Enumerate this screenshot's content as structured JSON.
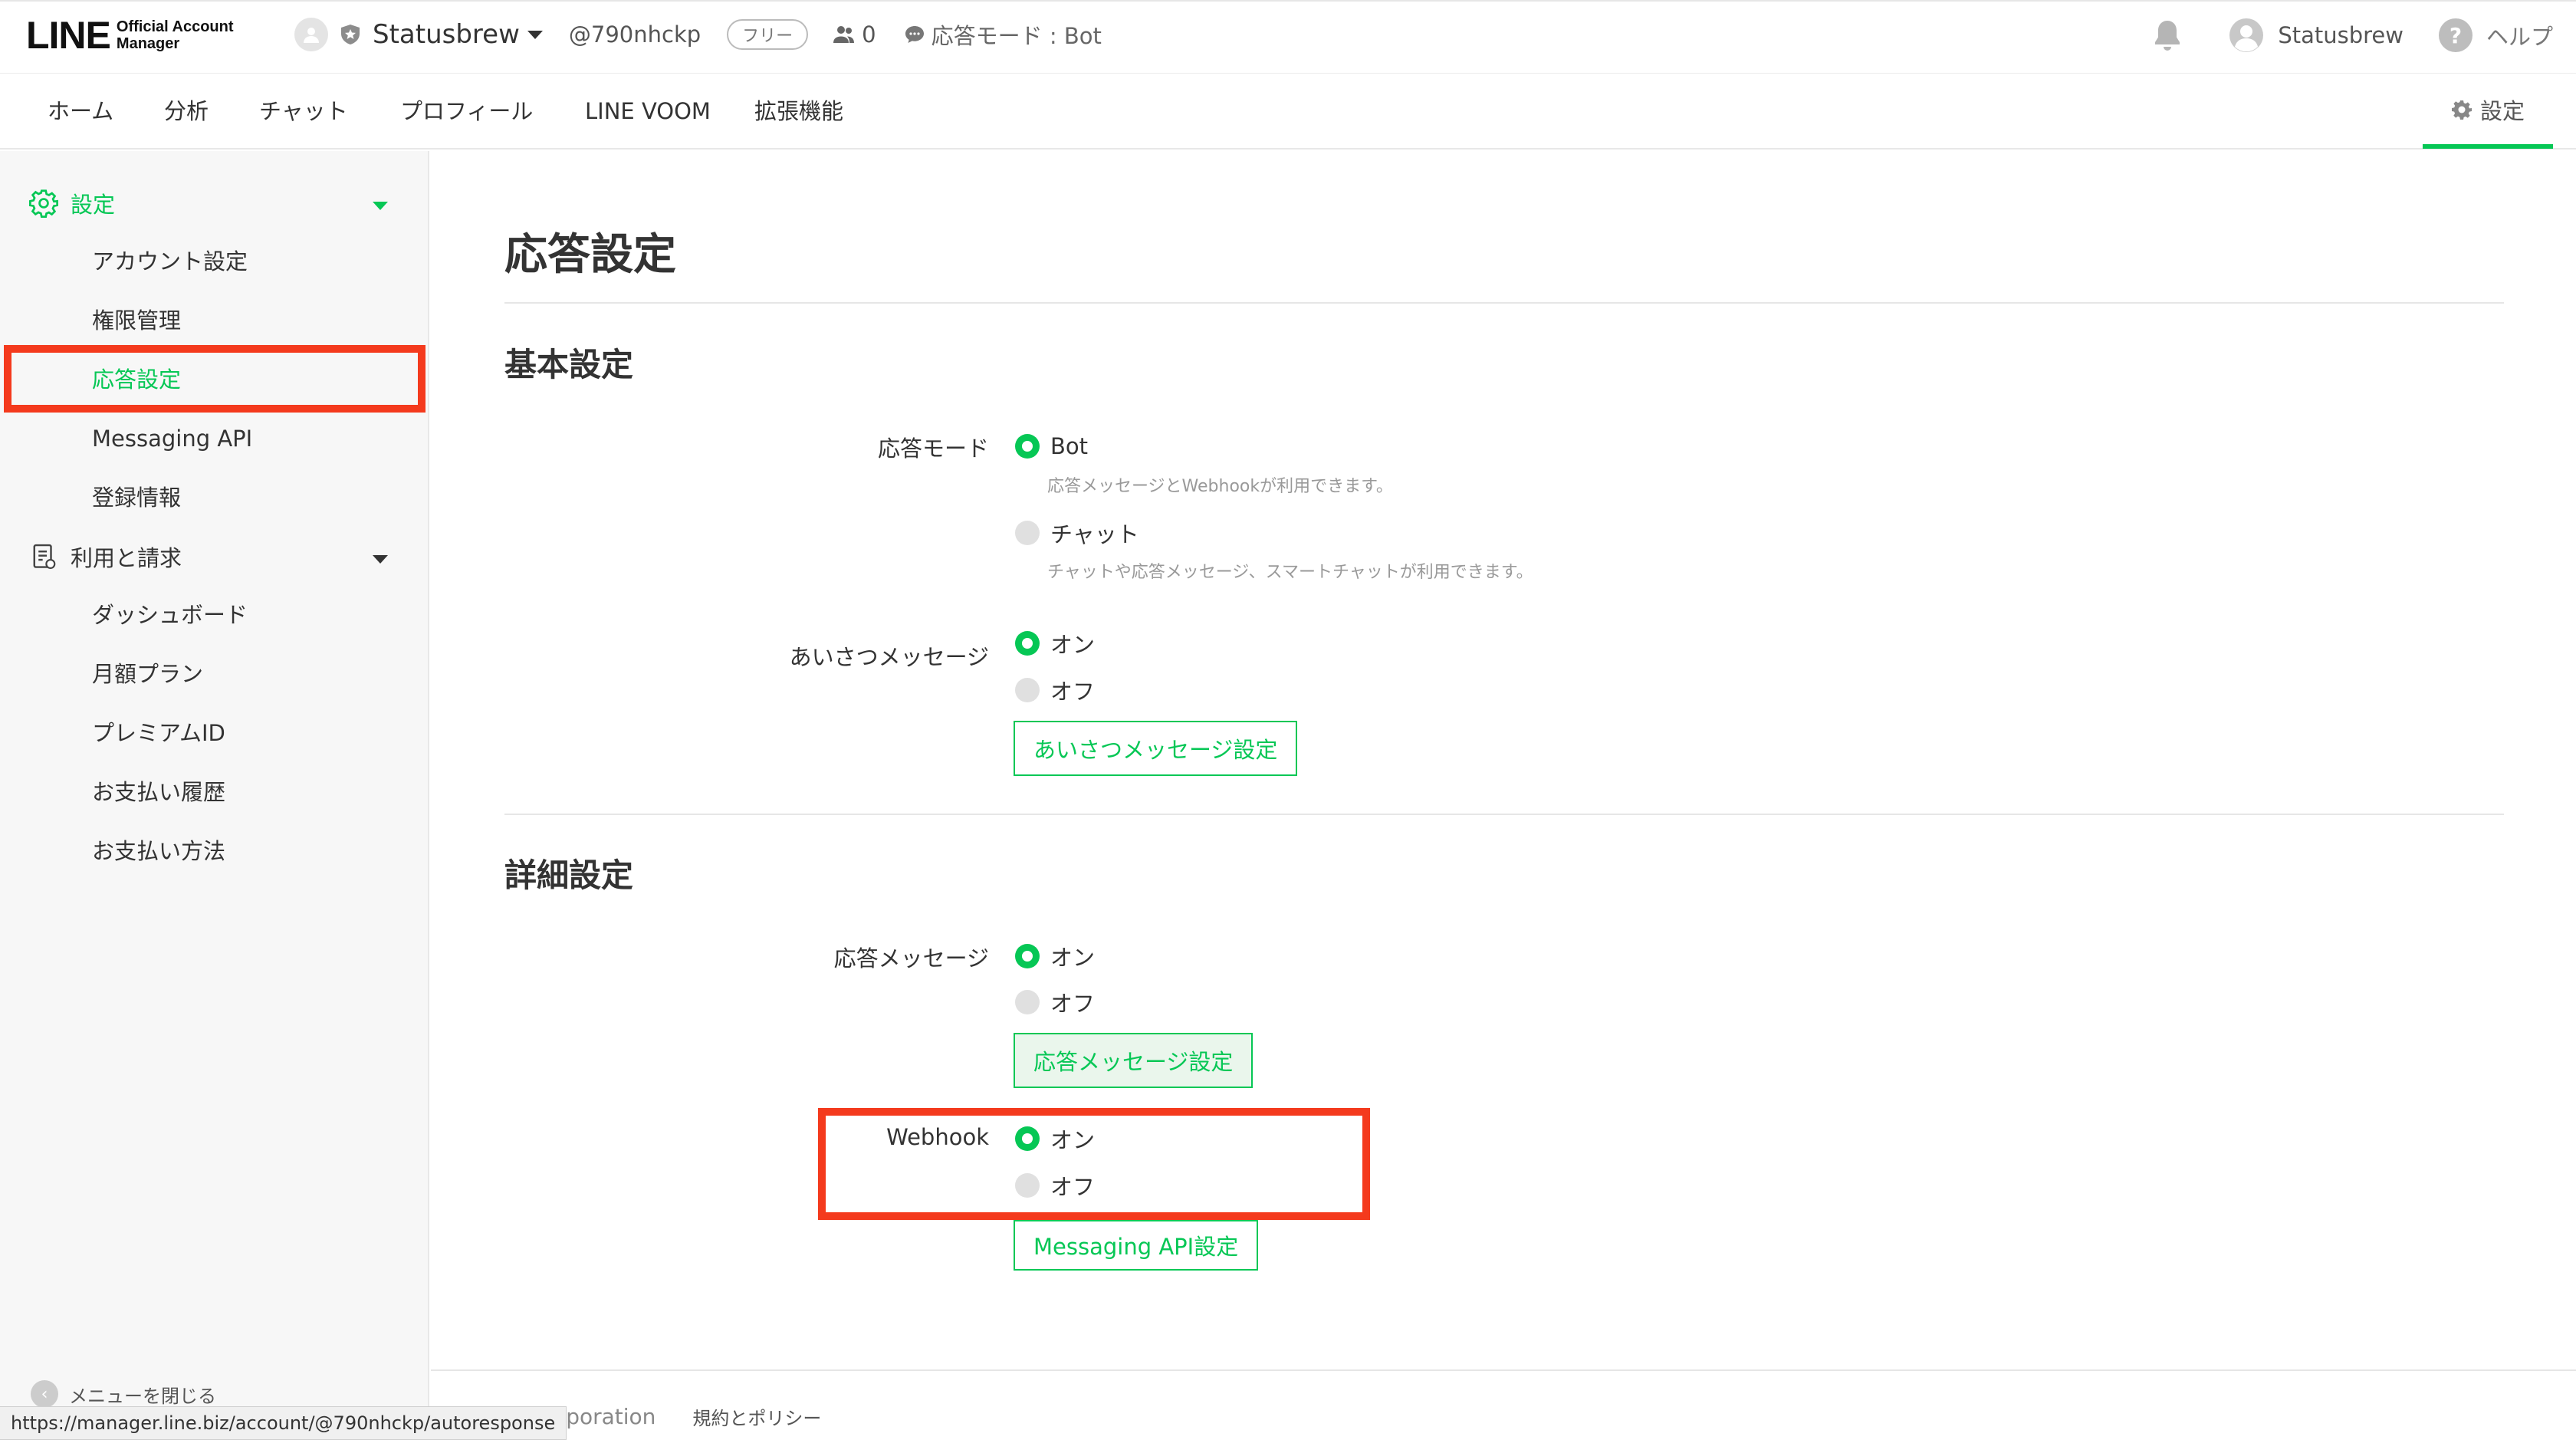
{
  "header": {
    "logo_text": "LINE",
    "logo_sub_line1": "Official Account",
    "logo_sub_line2": "Manager",
    "account_name": "Statusbrew",
    "account_id": "@790nhckp",
    "plan_badge": "フリー",
    "followers_count": "0",
    "mode_indicator": "応答モード : Bot",
    "user_name": "Statusbrew",
    "help_label": "ヘルプ"
  },
  "nav": {
    "items": [
      {
        "label": "ホーム"
      },
      {
        "label": "分析"
      },
      {
        "label": "チャット"
      },
      {
        "label": "プロフィール"
      },
      {
        "label": "LINE VOOM"
      },
      {
        "label": "拡張機能"
      }
    ],
    "settings_label": "設定"
  },
  "sidebar": {
    "group_settings": "設定",
    "settings_items": [
      {
        "label": "アカウント設定"
      },
      {
        "label": "権限管理"
      },
      {
        "label": "応答設定",
        "active": true
      },
      {
        "label": "Messaging API"
      },
      {
        "label": "登録情報"
      }
    ],
    "group_billing": "利用と請求",
    "billing_items": [
      {
        "label": "ダッシュボード"
      },
      {
        "label": "月額プラン"
      },
      {
        "label": "プレミアムID"
      },
      {
        "label": "お支払い履歴"
      },
      {
        "label": "お支払い方法"
      }
    ],
    "close_menu": "メニューを閉じる"
  },
  "main": {
    "page_title": "応答設定",
    "basic_section": {
      "title": "基本設定",
      "response_mode": {
        "label": "応答モード",
        "bot_label": "Bot",
        "bot_desc": "応答メッセージとWebhookが利用できます。",
        "chat_label": "チャット",
        "chat_desc": "チャットや応答メッセージ、スマートチャットが利用できます。"
      },
      "greeting": {
        "label": "あいさつメッセージ",
        "on_label": "オン",
        "off_label": "オフ",
        "button_label": "あいさつメッセージ設定"
      }
    },
    "detail_section": {
      "title": "詳細設定",
      "auto_response": {
        "label": "応答メッセージ",
        "on_label": "オン",
        "off_label": "オフ",
        "button_label": "応答メッセージ設定"
      },
      "webhook": {
        "label": "Webhook",
        "on_label": "オン",
        "off_label": "オフ",
        "button_label": "Messaging API設定"
      }
    }
  },
  "footer": {
    "corp": "Corporation",
    "policy": "規約とポリシー"
  },
  "status_bar": {
    "url": "https://manager.line.biz/account/@790nhckp/autoresponse"
  },
  "colors": {
    "accent": "#06c755",
    "highlight": "#f43a1d"
  }
}
